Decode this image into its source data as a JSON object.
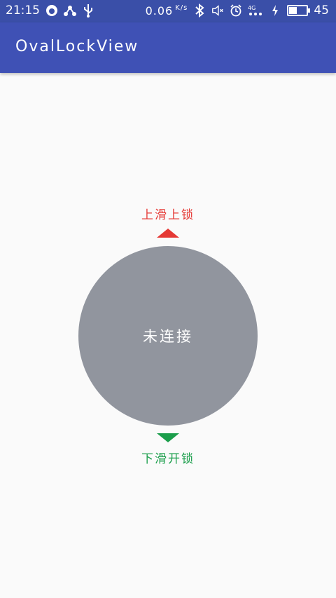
{
  "status_bar": {
    "time": "21:15",
    "net_speed": "0.06",
    "net_speed_unit": "K/s",
    "network_label": "4G",
    "battery_level": "45",
    "battery_fraction": 0.45
  },
  "app_bar": {
    "title": "OvalLockView"
  },
  "lock": {
    "up_hint": "上滑上锁",
    "status": "未连接",
    "down_hint": "下滑开锁"
  },
  "colors": {
    "app_bar": "#3f51b5",
    "status_bar": "#3a4fa8",
    "up_hint": "#e53935",
    "down_hint": "#1b9e4b",
    "circle": "#91959e",
    "background": "#fafafa"
  }
}
